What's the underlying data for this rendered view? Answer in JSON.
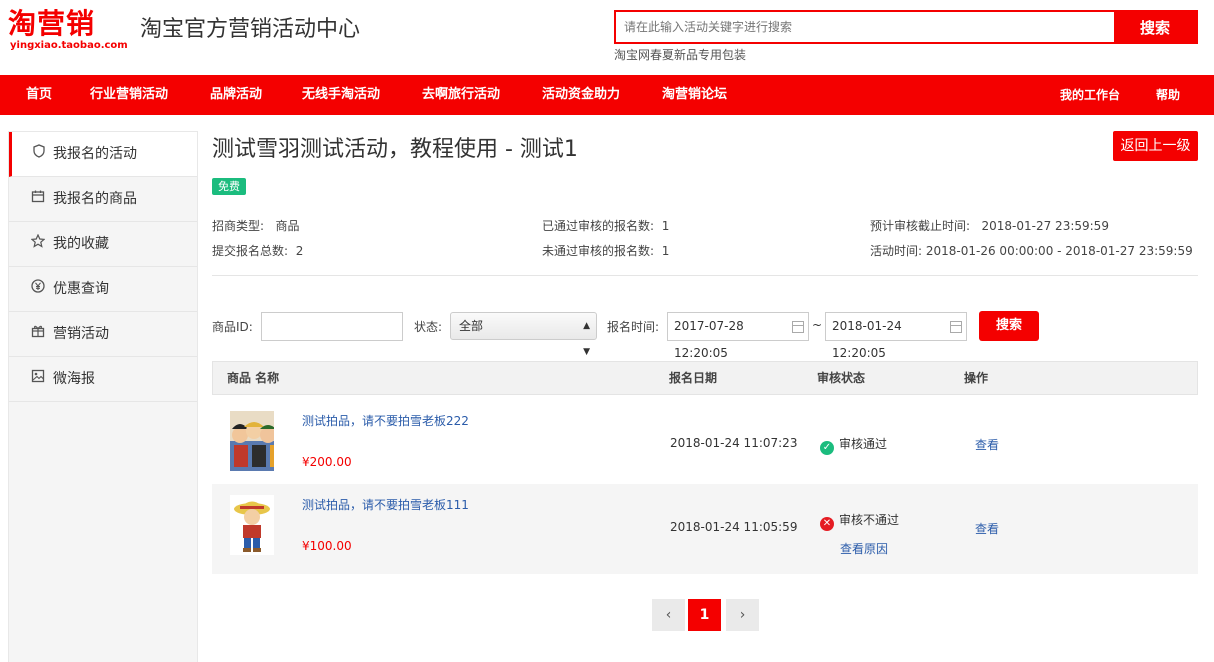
{
  "header": {
    "logo_text": "淘营销",
    "logo_domain": "yingxiao.taobao.com",
    "site_title": "淘宝官方营销活动中心",
    "search_placeholder": "请在此输入活动关键字进行搜索",
    "search_button": "搜索",
    "search_hint": "淘宝网春夏新品专用包装"
  },
  "nav": {
    "items": [
      "首页",
      "行业营销活动",
      "品牌活动",
      "无线手淘活动",
      "去啊旅行活动",
      "活动资金助力",
      "淘营销论坛"
    ],
    "right": [
      "我的工作台",
      "帮助"
    ]
  },
  "sidebar": {
    "items": [
      {
        "label": "我报名的活动",
        "icon": "badge-icon"
      },
      {
        "label": "我报名的商品",
        "icon": "calendar-icon"
      },
      {
        "label": "我的收藏",
        "icon": "star-icon"
      },
      {
        "label": "优惠查询",
        "icon": "yuan-icon"
      },
      {
        "label": "营销活动",
        "icon": "gift-icon"
      },
      {
        "label": "微海报",
        "icon": "image-icon"
      }
    ]
  },
  "activity": {
    "title": "测试雪羽测试活动，教程使用 - 测试1",
    "back_button": "返回上一级",
    "badge": "免费",
    "info": {
      "type_label": "招商类型:",
      "type_value": "商品",
      "total_label": "提交报名总数:",
      "total_value": "2",
      "passed_label": "已通过审核的报名数:",
      "passed_value": "1",
      "failed_label": "未通过审核的报名数:",
      "failed_value": "1",
      "deadline_label": "预计审核截止时间:",
      "deadline_value": "2018-01-27 23:59:59",
      "time_label": "活动时间:",
      "time_value": "2018-01-26 00:00:00 - 2018-01-27 23:59:59"
    }
  },
  "filters": {
    "product_id_label": "商品ID:",
    "product_id_value": "",
    "status_label": "状态:",
    "status_value": "全部",
    "time_label": "报名时间:",
    "start_time": "2017-07-28 12:20:05",
    "end_time": "2018-01-24 12:20:05",
    "tilde": "~",
    "search_button": "搜索"
  },
  "table": {
    "headers": [
      "商品 名称",
      "报名日期",
      "审核状态",
      "操作"
    ],
    "rows": [
      {
        "name": "测试拍品，请不要拍雪老板222",
        "price": "¥200.00",
        "date": "2018-01-24 11:07:23",
        "status": "审核通过",
        "reason": "",
        "action": "查看"
      },
      {
        "name": "测试拍品，请不要拍雪老板111",
        "price": "¥100.00",
        "date": "2018-01-24 11:05:59",
        "status": "审核不通过",
        "reason": "查看原因",
        "action": "查看"
      }
    ]
  },
  "pagination": {
    "prev": "‹",
    "current": "1",
    "next": "›"
  },
  "colors": {
    "brand": "#f40000",
    "success": "#1bbc7e",
    "danger": "#e51c23",
    "link": "#2b5caa"
  }
}
